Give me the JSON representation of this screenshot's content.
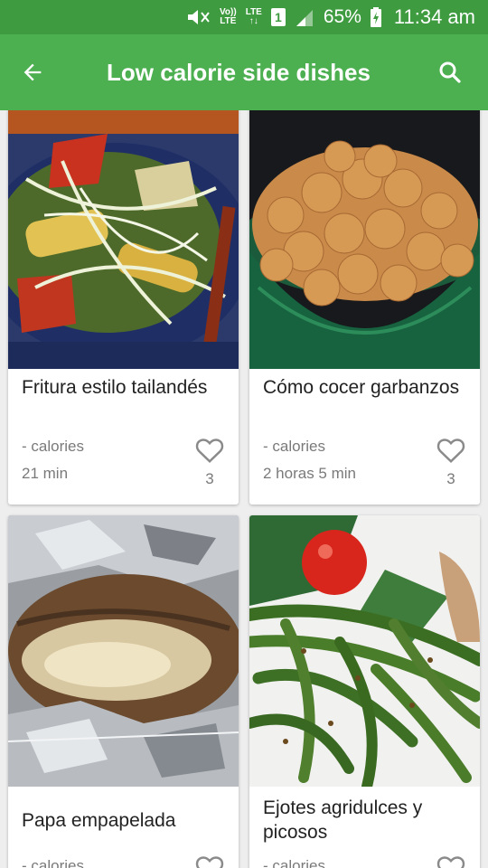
{
  "status_bar": {
    "volte_top": "Vo))",
    "volte_bottom": "LTE",
    "lte_top": "LTE",
    "lte_bottom": "↑↓",
    "sim": "1",
    "battery": "65%",
    "time": "11:34 am"
  },
  "app_bar": {
    "title": "Low calorie side dishes",
    "back_icon": "arrow-back-icon",
    "search_icon": "search-icon"
  },
  "recipes": [
    {
      "title": "Fritura estilo tailandés",
      "calories": "- calories",
      "time": "21 min",
      "likes": "3",
      "image": "thai-stir-fry-photo"
    },
    {
      "title": "Cómo cocer garbanzos",
      "calories": "- calories",
      "time": "2 horas 5 min",
      "likes": "3",
      "image": "chickpeas-bowl-photo"
    },
    {
      "title": "Papa empapelada",
      "calories": "- calories",
      "time": "",
      "likes": "",
      "image": "foil-potato-photo"
    },
    {
      "title": "Ejotes agridulces y picosos",
      "calories": "- calories",
      "time": "",
      "likes": "",
      "image": "green-beans-photo"
    }
  ],
  "colors": {
    "status_bar": "#3e9b40",
    "app_bar": "#4caf50",
    "background": "#eeeeee",
    "card": "#ffffff",
    "secondary_text": "#7a7a7a"
  }
}
